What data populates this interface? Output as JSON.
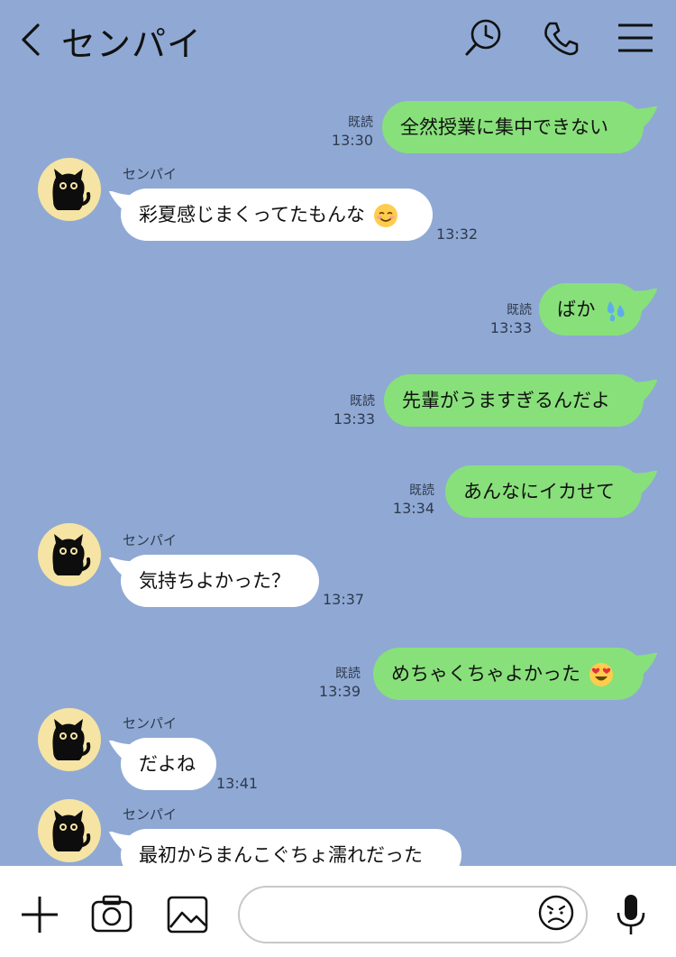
{
  "header": {
    "title": "センパイ"
  },
  "messages": [
    {
      "direction": "sent",
      "text": "全然授業に集中できない",
      "read_label": "既読",
      "time": "13:30"
    },
    {
      "direction": "received",
      "sender": "センパイ",
      "text": "彩夏感じまくってたもんな",
      "emoji": "smiling-face",
      "time": "13:32"
    },
    {
      "direction": "sent",
      "text": "ばか",
      "emoji": "sweat-droplets",
      "read_label": "既読",
      "time": "13:33"
    },
    {
      "direction": "sent",
      "text": "先輩がうますぎるんだよ",
      "read_label": "既読",
      "time": "13:33"
    },
    {
      "direction": "sent",
      "text": "あんなにイカせて",
      "read_label": "既読",
      "time": "13:34"
    },
    {
      "direction": "received",
      "sender": "センパイ",
      "text": "気持ちよかった？",
      "time": "13:37"
    },
    {
      "direction": "sent",
      "text": "めちゃくちゃよかった",
      "emoji": "heart-eyes",
      "read_label": "既読",
      "time": "13:39"
    },
    {
      "direction": "received",
      "sender": "センパイ",
      "text": "だよね",
      "time": "13:41"
    },
    {
      "direction": "received",
      "sender": "センパイ",
      "text": "最初からまんこぐちょ濡れだった",
      "time": ""
    }
  ],
  "input": {
    "value": "",
    "placeholder": ""
  },
  "colors": {
    "background": "#8fa9d4",
    "sent_bubble": "#88e07a",
    "received_bubble": "#ffffff",
    "avatar_bg": "#f6e4a4"
  },
  "icons": {
    "header": [
      "chevron-left-icon",
      "search-clock-icon",
      "phone-icon",
      "menu-icon"
    ],
    "bottom": [
      "plus-icon",
      "camera-icon",
      "image-icon",
      "sticker-face-icon",
      "microphone-icon"
    ]
  }
}
